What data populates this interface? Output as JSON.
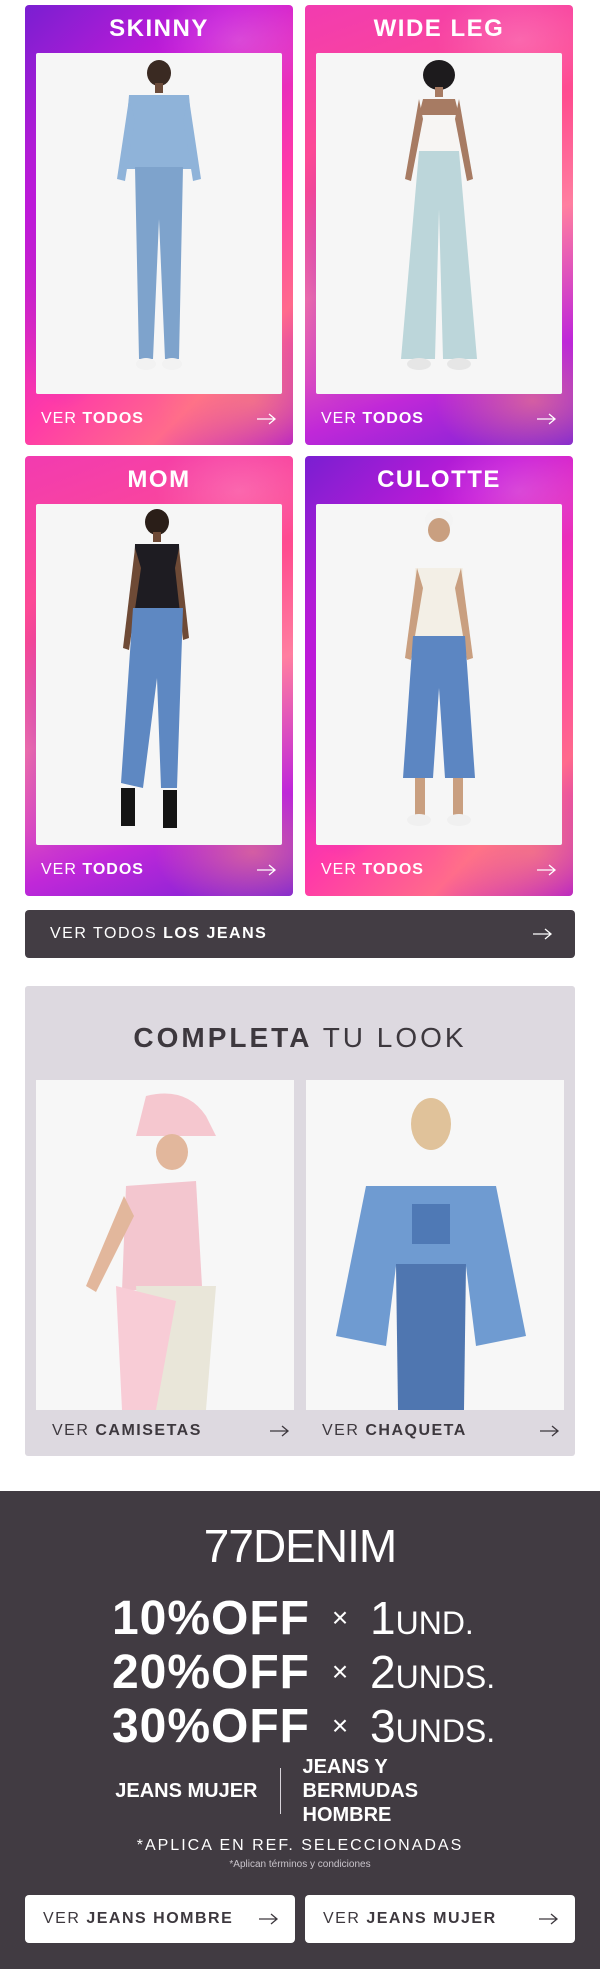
{
  "categories": [
    {
      "title": "SKINNY",
      "cta_prefix": "VER ",
      "cta_bold": "TODOS"
    },
    {
      "title": "WIDE LEG",
      "cta_prefix": "VER ",
      "cta_bold": "TODOS"
    },
    {
      "title": "MOM",
      "cta_prefix": "VER ",
      "cta_bold": "TODOS"
    },
    {
      "title": "CULOTTE",
      "cta_prefix": "VER ",
      "cta_bold": "TODOS"
    }
  ],
  "all_jeans": {
    "prefix": "VER TODOS ",
    "bold": "LOS JEANS"
  },
  "look": {
    "title_bold": "COMPLETA",
    "title_rest": " TU LOOK",
    "items": [
      {
        "prefix": "VER ",
        "bold": "CAMISETAS"
      },
      {
        "prefix": "VER ",
        "bold": "CHAQUETA"
      }
    ]
  },
  "promo": {
    "brand": "77DENIM",
    "offers": [
      {
        "pct": "10%OFF",
        "x": "×",
        "qty": "1",
        "unit": "UND."
      },
      {
        "pct": "20%OFF",
        "x": "×",
        "qty": "2",
        "unit": "UNDS."
      },
      {
        "pct": "30%OFF",
        "x": "×",
        "qty": "3",
        "unit": "UNDS."
      }
    ],
    "segment_left": "JEANS MUJER",
    "segment_right": "JEANS Y BERMUDAS HOMBRE",
    "note": "*APLICA EN REF. SELECCIONADAS",
    "terms": "*Aplican términos y condiciones",
    "buttons": [
      {
        "prefix": "VER ",
        "bold": "JEANS HOMBRE"
      },
      {
        "prefix": "VER ",
        "bold": "JEANS MUJER"
      }
    ]
  },
  "colors": {
    "dark": "#433d44",
    "look_bg": "#ddd9e0",
    "promo_bg": "#413b42",
    "pink": "#ff3aa8",
    "purple": "#7a1fd1"
  },
  "icons": {
    "arrow": "arrow-right-icon"
  }
}
